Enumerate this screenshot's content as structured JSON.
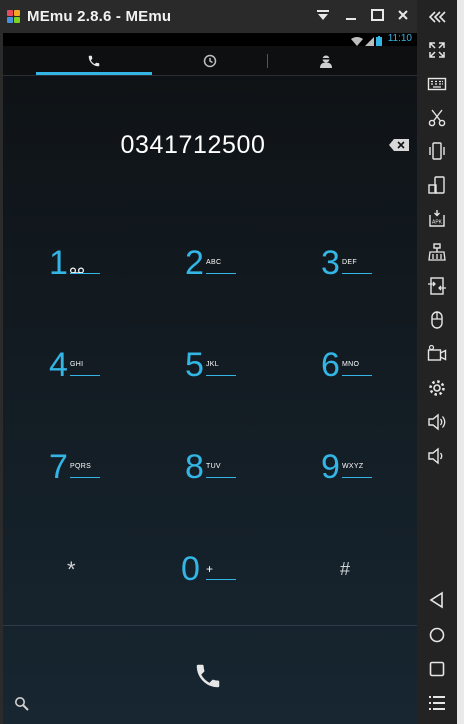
{
  "window": {
    "title": "MEmu 2.8.6 - MEmu"
  },
  "status_bar": {
    "time": "11:10"
  },
  "dialer": {
    "number": "0341712500",
    "keys": [
      {
        "digit": "1",
        "letters": ""
      },
      {
        "digit": "2",
        "letters": "ABC"
      },
      {
        "digit": "3",
        "letters": "DEF"
      },
      {
        "digit": "4",
        "letters": "GHI"
      },
      {
        "digit": "5",
        "letters": "JKL"
      },
      {
        "digit": "6",
        "letters": "MNO"
      },
      {
        "digit": "7",
        "letters": "PQRS"
      },
      {
        "digit": "8",
        "letters": "TUV"
      },
      {
        "digit": "9",
        "letters": "WXYZ"
      },
      {
        "digit": "*",
        "letters": ""
      },
      {
        "digit": "0",
        "letters": "+"
      },
      {
        "digit": "#",
        "letters": ""
      }
    ]
  },
  "colors": {
    "accent": "#33b5e5",
    "title_bar": "#2a2a2a",
    "sidebar": "#232323"
  },
  "icons": {
    "tabs": [
      "phone-icon",
      "recent-clock-icon",
      "contacts-icon"
    ],
    "sidebar": [
      "collapse-icon",
      "fullscreen-icon",
      "keyboard-icon",
      "scissors-icon",
      "shake-icon",
      "rotate-icon",
      "apk-install-icon",
      "clean-broom-icon",
      "transfer-icon",
      "mouse-icon",
      "record-video-icon",
      "settings-icon",
      "volume-up-icon",
      "volume-down-icon",
      "back-icon",
      "home-icon",
      "recents-icon",
      "menu-icon"
    ]
  }
}
